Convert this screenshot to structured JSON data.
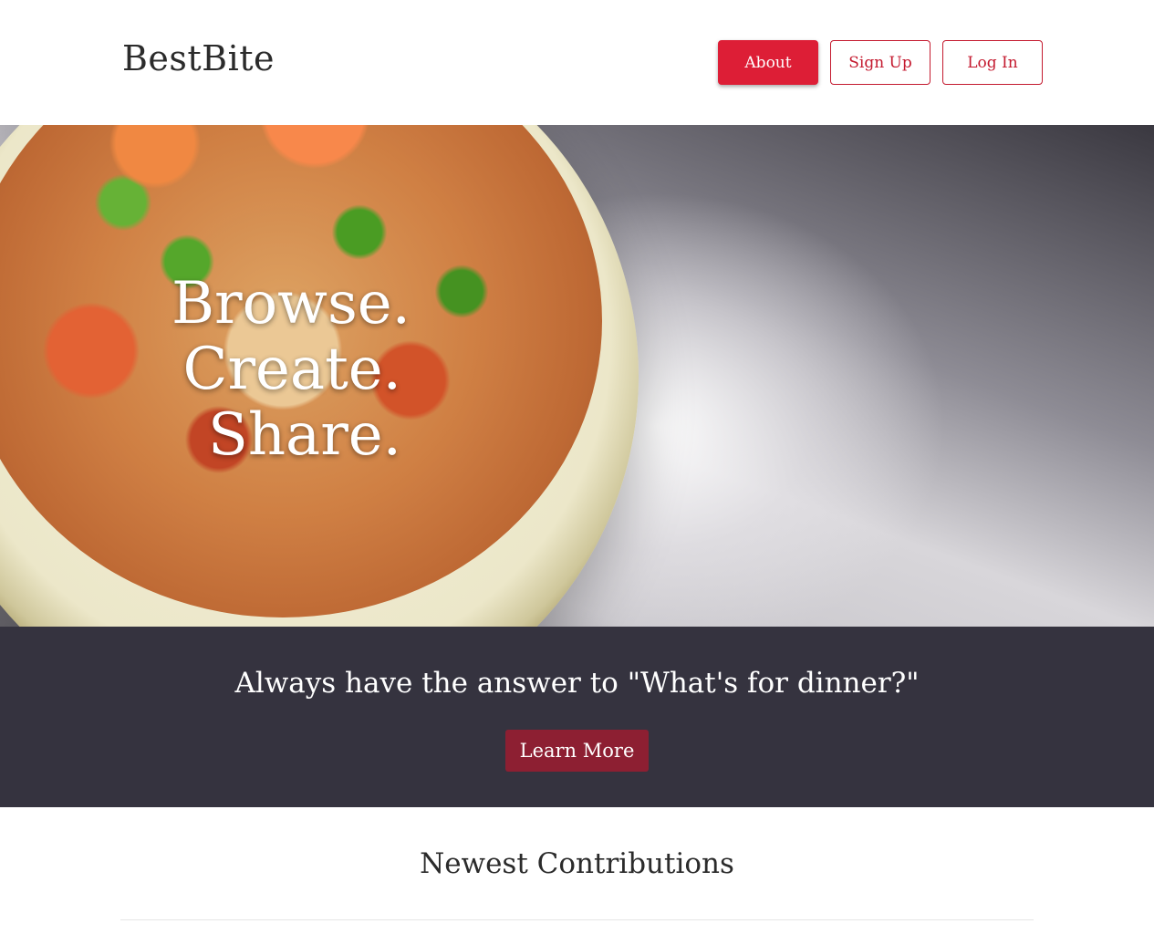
{
  "brand": {
    "name": "BestBite"
  },
  "nav": {
    "about": "About",
    "signup": "Sign Up",
    "login": "Log In"
  },
  "hero": {
    "lines": [
      "Browse.",
      "Create.",
      "Share."
    ]
  },
  "band": {
    "tagline": "Always have the answer to \"What's for dinner?\"",
    "cta": "Learn More"
  },
  "newest": {
    "title": "Newest Contributions"
  },
  "colors": {
    "accent": "#dd1e36",
    "cta": "#8d1f32",
    "band": "#35333f"
  }
}
